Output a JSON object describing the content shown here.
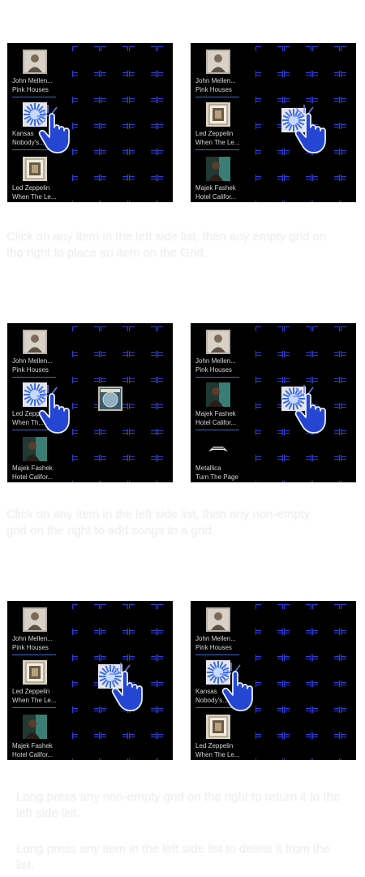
{
  "screens": [
    {
      "list": [
        {
          "artist": "John Mellen...",
          "title": "Pink Houses",
          "art": "portrait"
        },
        {
          "artist": "Kansas",
          "title": "Nobody's...",
          "art": "sunburst"
        },
        {
          "artist": "Led Zeppelin",
          "title": "When The Le...",
          "art": "zeppelin"
        }
      ]
    },
    {
      "list": [
        {
          "artist": "John Mellen...",
          "title": "Pink Houses",
          "art": "portrait"
        },
        {
          "artist": "Led Zeppelin",
          "title": "When The Le...",
          "art": "zeppelin"
        },
        {
          "artist": "Majek Fashek",
          "title": "Hotel Califor...",
          "art": "fashek"
        }
      ]
    },
    {
      "list": [
        {
          "artist": "John Mellen...",
          "title": "Pink Houses",
          "art": "portrait"
        },
        {
          "artist": "Led Zepp...",
          "title": "When Th...",
          "art": "sunburst"
        },
        {
          "artist": "Majek Fashek",
          "title": "Hotel Califor...",
          "art": "fashek"
        }
      ]
    },
    {
      "list": [
        {
          "artist": "John Mellen...",
          "title": "Pink Houses",
          "art": "portrait"
        },
        {
          "artist": "Majek Fashek",
          "title": "Hotel Califor...",
          "art": "fashek"
        },
        {
          "artist": "Metallica",
          "title": "Turn The Page",
          "art": "metallica"
        }
      ]
    },
    {
      "list": [
        {
          "artist": "John Mellen...",
          "title": "Pink Houses",
          "art": "portrait"
        },
        {
          "artist": "Led Zeppelin",
          "title": "When The Le...",
          "art": "zeppelin"
        },
        {
          "artist": "Majek Fashek",
          "title": "Hotel Califor...",
          "art": "fashek"
        }
      ]
    },
    {
      "list": [
        {
          "artist": "John Mellen...",
          "title": "Pink Houses",
          "art": "portrait"
        },
        {
          "artist": "Kansas",
          "title": "Nobody's...",
          "art": "sunburst"
        },
        {
          "artist": "Led Zeppelin",
          "title": "When The Le...",
          "art": "zeppelin"
        }
      ]
    }
  ],
  "captions": [
    "Click on any item in the left side list, then any empty grid on the right to place an item on the Grid.",
    "Click on any item in the left side list, then any non-empty grid on the right to add songs to a grid.",
    "Long press any non-empty grid on the right to return it to the left side list.",
    "Long press any item in the left side list to delete it from the list."
  ],
  "colors": {
    "grid_lines": "#2f3fd8",
    "underline": "#3c6bd6",
    "hand": "#2546d2",
    "panel_bg": "#000000"
  }
}
